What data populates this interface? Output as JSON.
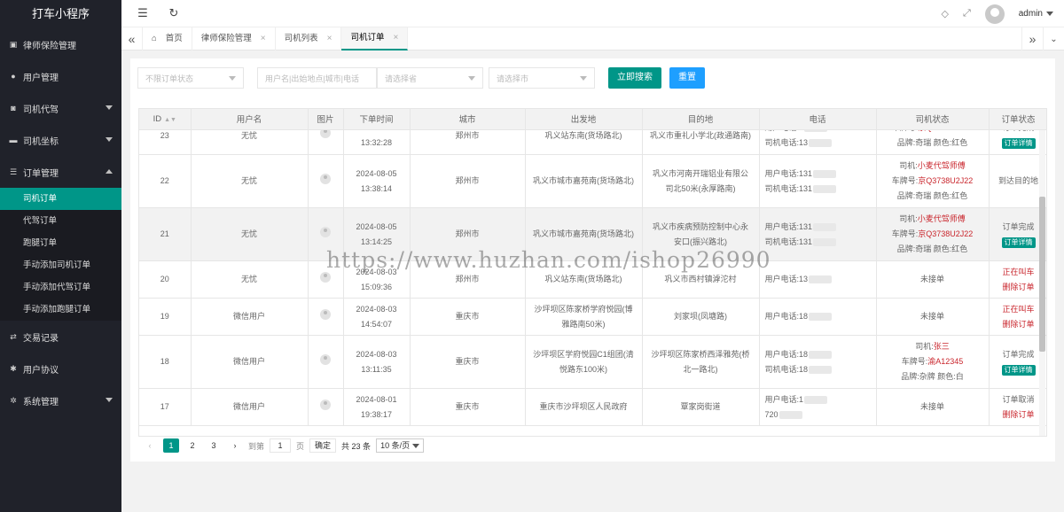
{
  "app": {
    "title": "打车小程序"
  },
  "sidebar": {
    "items": [
      {
        "label": "律师保险管理",
        "icon": "id-card-icon",
        "caret": false
      },
      {
        "label": "用户管理",
        "icon": "user-icon",
        "caret": false
      },
      {
        "label": "司机代驾",
        "icon": "car-icon",
        "caret": true
      },
      {
        "label": "司机坐标",
        "icon": "car-side-icon",
        "caret": true
      },
      {
        "label": "订单管理",
        "icon": "list-icon",
        "caret": true,
        "expanded": true
      },
      {
        "label": "交易记录",
        "icon": "exchange-icon",
        "caret": false
      },
      {
        "label": "用户协议",
        "icon": "gear-small-icon",
        "caret": false
      },
      {
        "label": "系统管理",
        "icon": "settings-icon",
        "caret": true
      }
    ],
    "order_sub": [
      "司机订单",
      "代驾订单",
      "跑腿订单",
      "手动添加司机订单",
      "手动添加代驾订单",
      "手动添加跑腿订单"
    ]
  },
  "header": {
    "username": "admin"
  },
  "tabs": [
    {
      "label": "首页",
      "closable": false
    },
    {
      "label": "律师保险管理",
      "closable": true
    },
    {
      "label": "司机列表",
      "closable": true
    },
    {
      "label": "司机订单",
      "closable": true,
      "active": true
    }
  ],
  "filters": {
    "status_placeholder": "不限订单状态",
    "search_placeholder": "用户名|出始地点|城市|电话",
    "province_placeholder": "请选择省",
    "city_placeholder": "请选择市",
    "search_label": "立即搜索",
    "reset_label": "重置"
  },
  "table": {
    "columns": [
      "ID",
      "用户名",
      "图片",
      "下单时间",
      "城市",
      "出发地",
      "目的地",
      "电话",
      "司机状态",
      "订单状态"
    ],
    "rows": [
      {
        "id": "23",
        "user": "无忧",
        "date": "2024-08-06",
        "time": "13:32:28",
        "city": "郑州市",
        "from": [
          "巩义站东南(货场路北)"
        ],
        "to": [
          "巩义市重礼小学北(政通路南)"
        ],
        "phones": [
          "用户电话:1",
          "司机电话:13"
        ],
        "driver": null,
        "plate": "车牌号:",
        "plate_val": "京Q3738U2J22",
        "brand": "品牌:奇瑞 颜色:红色",
        "status": "订单完成",
        "action": "订单详情",
        "status_red": false,
        "action_badge": true
      },
      {
        "id": "22",
        "user": "无忧",
        "date": "2024-08-05",
        "time": "13:38:14",
        "city": "郑州市",
        "from": [
          "巩义市城市嘉苑南(货场路北)"
        ],
        "to": [
          "巩义市河南开瑞铝业有限公",
          "司北50米(永厚路南)"
        ],
        "phones": [
          "用户电话:131",
          "司机电话:131"
        ],
        "driver_prefix": "司机:",
        "driver": "小麦代驾师傅",
        "plate": "车牌号:",
        "plate_val": "京Q3738U2J22",
        "brand": "品牌:奇瑞 颜色:红色",
        "status": "到达目的地",
        "action": "",
        "status_red": false,
        "action_badge": false
      },
      {
        "id": "21",
        "user": "无忧",
        "date": "2024-08-05",
        "time": "13:14:25",
        "city": "郑州市",
        "from": [
          "巩义市城市嘉苑南(货场路北)"
        ],
        "to": [
          "巩义市疾病预防控制中心永",
          "安口(振兴路北)"
        ],
        "phones": [
          "用户电话:131",
          "司机电话:131"
        ],
        "driver_prefix": "司机:",
        "driver": "小麦代驾师傅",
        "plate": "车牌号:",
        "plate_val": "京Q3738U2J22",
        "brand": "品牌:奇瑞 颜色:红色",
        "status": "订单完成",
        "action": "订单详情",
        "status_red": false,
        "action_badge": true,
        "highlight": true
      },
      {
        "id": "20",
        "user": "无忧",
        "date": "2024-08-03",
        "time": "15:09:36",
        "city": "郑州市",
        "from": [
          "巩义站东南(货场路北)"
        ],
        "to": [
          "巩义市西村镇滹沱村"
        ],
        "phones": [
          "用户电话:13"
        ],
        "driver_text": "未接单",
        "status": "正在叫车",
        "action": "删除订单",
        "status_red": true,
        "action_badge": false
      },
      {
        "id": "19",
        "user": "微信用户",
        "date": "2024-08-03",
        "time": "14:54:07",
        "city": "重庆市",
        "from": [
          "沙坪坝区陈家桥学府悦园(博",
          "雅路南50米)"
        ],
        "to": [
          "刘家坝(凤塘路)"
        ],
        "phones": [
          "用户电话:18"
        ],
        "driver_text": "未接单",
        "status": "正在叫车",
        "action": "删除订单",
        "status_red": true,
        "action_badge": false
      },
      {
        "id": "18",
        "user": "微信用户",
        "date": "2024-08-03",
        "time": "13:11:35",
        "city": "重庆市",
        "from": [
          "沙坪坝区学府悦园C1组团(清",
          "悦路东100米)"
        ],
        "to": [
          "沙坪坝区陈家桥西泽雅苑(桥",
          "北一路北)"
        ],
        "phones": [
          "用户电话:18",
          "司机电话:18"
        ],
        "driver_prefix": "司机:",
        "driver": "张三",
        "plate": "车牌号:",
        "plate_val": "渝A12345",
        "brand": "品牌:杂牌 颜色:白",
        "status": "订单完成",
        "action": "订单详情",
        "status_red": false,
        "action_badge": true
      },
      {
        "id": "17",
        "user": "微信用户",
        "date": "2024-08-01",
        "time": "19:38:17",
        "city": "重庆市",
        "from": [
          "重庆市沙坪坝区人民政府"
        ],
        "to": [
          "覃家岗街道"
        ],
        "phones": [
          "用户电话:1",
          "720"
        ],
        "driver_text": "未接单",
        "status": "订单取消",
        "action": "删除订单",
        "status_red": false,
        "action_badge": false,
        "action_red": true
      }
    ]
  },
  "pager": {
    "pages": [
      "1",
      "2",
      "3"
    ],
    "goto_label": "到第",
    "page_value": "1",
    "page_unit": "页",
    "confirm_label": "确定",
    "total_label": "共 23 条",
    "size_label": "10 条/页"
  },
  "watermark": "https://www.huzhan.com/ishop26990"
}
